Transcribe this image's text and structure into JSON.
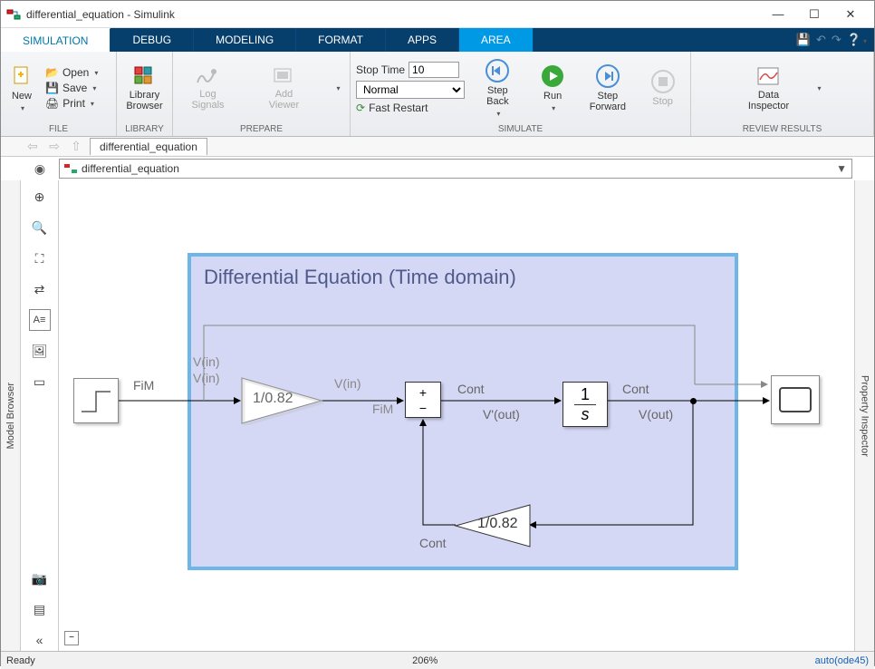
{
  "window": {
    "title": "differential_equation - Simulink"
  },
  "tabs": {
    "simulation": "SIMULATION",
    "debug": "DEBUG",
    "modeling": "MODELING",
    "format": "FORMAT",
    "apps": "APPS",
    "area": "AREA"
  },
  "ribbon": {
    "new": "New",
    "open": "Open",
    "save": "Save",
    "print": "Print",
    "file_group": "FILE",
    "library_browser": "Library\nBrowser",
    "library_group": "LIBRARY",
    "log_signals": "Log\nSignals",
    "add_viewer": "Add\nViewer",
    "prepare_group": "PREPARE",
    "stop_time_label": "Stop Time",
    "stop_time_value": "10",
    "mode": "Normal",
    "fast_restart": "Fast Restart",
    "step_back": "Step\nBack",
    "run": "Run",
    "step_forward": "Step\nForward",
    "stop": "Stop",
    "simulate_group": "SIMULATE",
    "data_inspector": "Data\nInspector",
    "review_group": "REVIEW RESULTS"
  },
  "breadcrumb": {
    "tab": "differential_equation",
    "path": "differential_equation"
  },
  "left_panel": "Model Browser",
  "right_panel": "Property Inspector",
  "diagram": {
    "area_title": "Differential Equation (Time domain)",
    "labels": {
      "fim": "FiM",
      "vin1": "V(in)",
      "vin2": "V(in)",
      "vin3": "V(in)",
      "fim2": "FiM",
      "cont1": "Cont",
      "vpout": "V'(out)",
      "cont2": "Cont",
      "vout": "V(out)",
      "cont3": "Cont"
    },
    "gain1": "1/0.82",
    "gain2": "1/0.82",
    "sum": {
      "plus": "+",
      "minus": "−"
    },
    "integrator": {
      "num": "1",
      "den": "s"
    }
  },
  "status": {
    "ready": "Ready",
    "zoom": "206%",
    "solver": "auto(ode45)"
  }
}
